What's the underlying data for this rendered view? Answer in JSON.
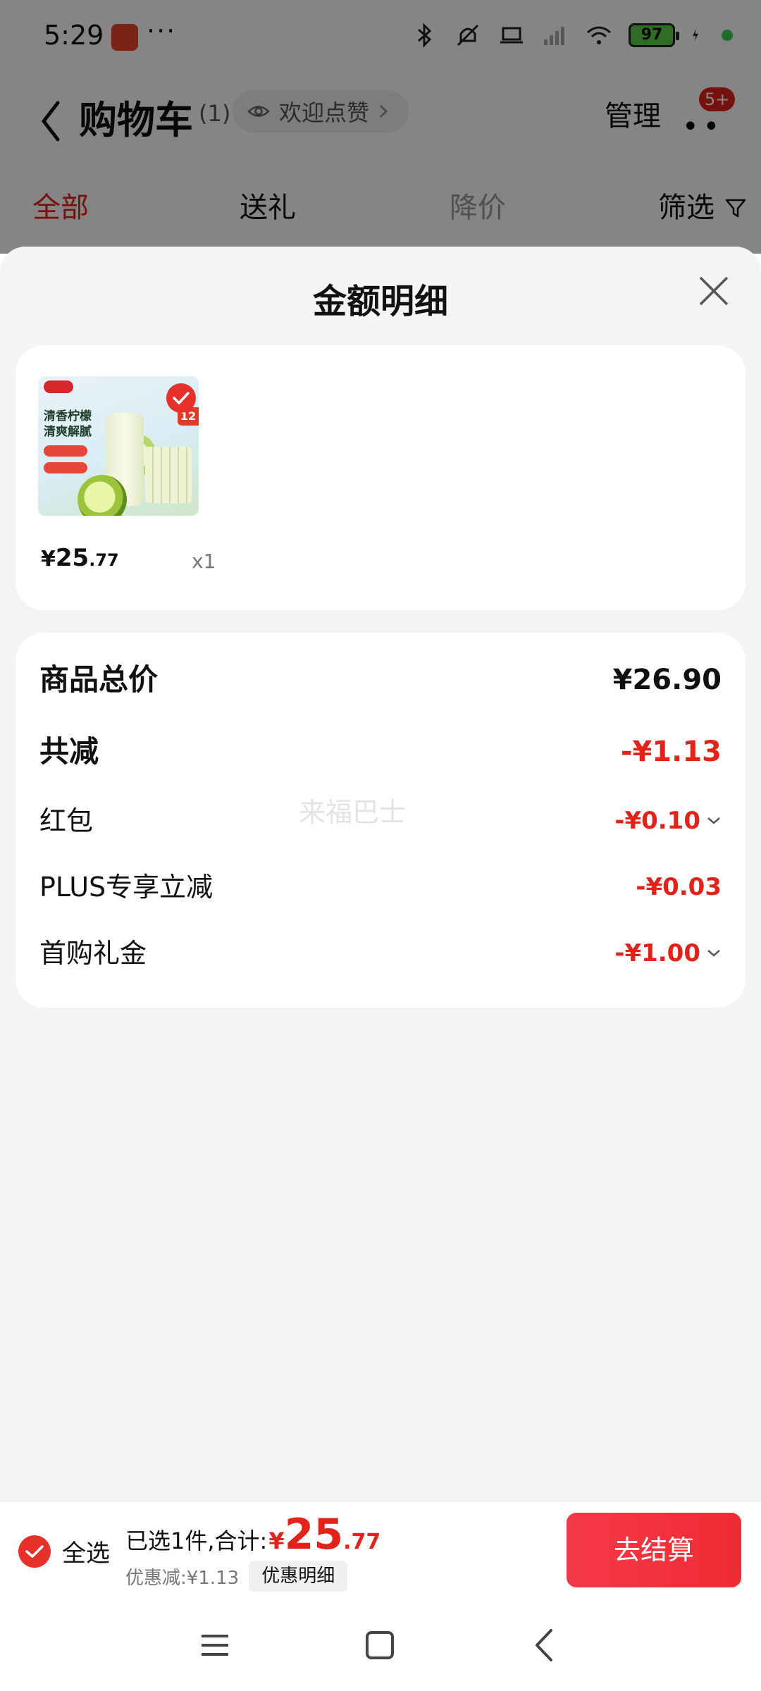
{
  "status_bar": {
    "time": "5:29",
    "more": "···",
    "battery": "97",
    "icons": [
      "app-icon",
      "bluetooth-icon",
      "mute-icon",
      "laptop-icon",
      "signal-icon",
      "wifi-icon",
      "battery-icon",
      "charging-icon"
    ]
  },
  "header": {
    "title": "购物车",
    "count": "(1)",
    "like_pill": "欢迎点赞",
    "manage": "管理",
    "badge": "5+"
  },
  "tabs": {
    "all": "全部",
    "gift": "送礼",
    "price_drop": "降价",
    "filter": "筛选"
  },
  "sheet": {
    "title": "金额明细",
    "product": {
      "price_symbol": "¥",
      "price_int": "25",
      "price_dec": ".77",
      "quantity": "x1",
      "image_text_1": "清香柠檬",
      "image_text_2": "清爽解腻",
      "image_tag": "12"
    },
    "summary": {
      "total_label": "商品总价",
      "total_value": "¥26.90",
      "discount_label": "共减",
      "discount_value": "-¥1.13",
      "red_packet_label": "红包",
      "red_packet_value": "-¥0.10",
      "plus_label": "PLUS专享立减",
      "plus_value": "-¥0.03",
      "first_buy_label": "首购礼金",
      "first_buy_value": "-¥1.00"
    },
    "watermark": "来福巴士"
  },
  "checkout": {
    "select_all": "全选",
    "selected_text": "已选1件,合计:",
    "total_symbol": "¥",
    "total_int": "25",
    "total_dec": ".77",
    "discount_text": "优惠减:¥1.13",
    "discount_detail": "优惠明细",
    "checkout_button": "去结算"
  },
  "colors": {
    "accent": "#e2231a",
    "button": "#ef2b33",
    "background": "#f4f4f4"
  }
}
